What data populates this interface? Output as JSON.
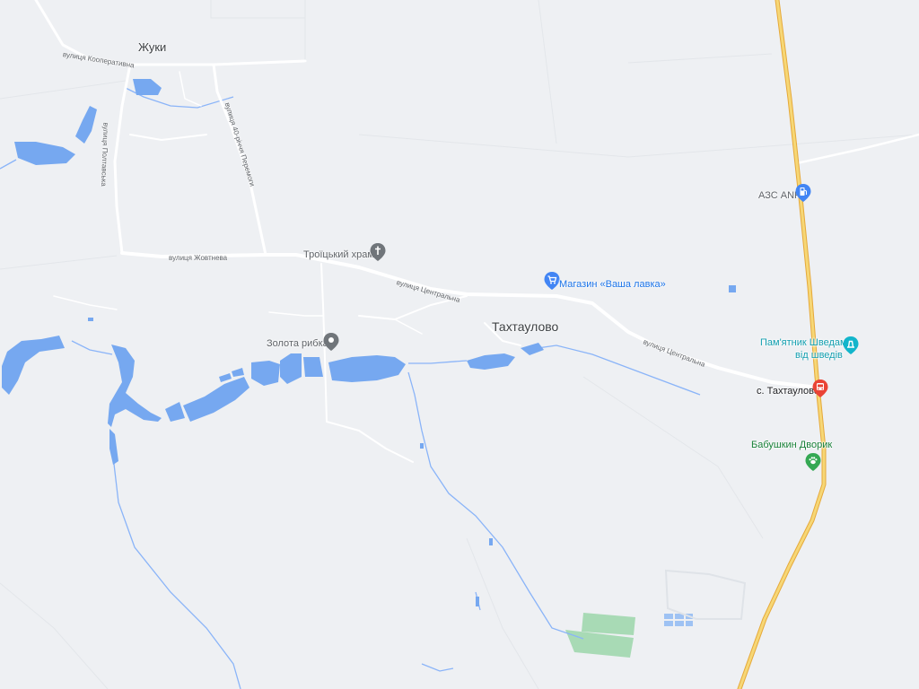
{
  "map": {
    "colors": {
      "land": "#eef0f3",
      "water": "#76a8f0",
      "road_minor": "#ffffff",
      "highway": "#f2c94c",
      "highway_edge": "#e6a93a",
      "park": "#a8dab5",
      "pin_gray": "#70757a",
      "pin_blue": "#4285f4",
      "pin_teal": "#12b5cb",
      "pin_red": "#ea4335",
      "pin_green": "#34a853"
    },
    "places": {
      "zhuky": "Жуки",
      "takhtaulovo": "Тахтаулово"
    },
    "streets": {
      "kooperatyvna": "вулиця Кооперативна",
      "poltavska": "вулиця Полтавська",
      "forty_years": "вулиця 40-річчя Перемоги",
      "zhovtneva": "вулиця Жовтнева",
      "tsentralna_1": "вулиця Центральна",
      "tsentralna_2": "вулиця Центральна"
    },
    "pois": {
      "church": {
        "label": "Троїцький храм",
        "icon": "church-icon"
      },
      "shop": {
        "label": "Магазин «Ваша лавка»",
        "icon": "shopping-cart-icon"
      },
      "fishing": {
        "label": "Золота рибка",
        "icon": "place-icon"
      },
      "gas": {
        "label": "АЗС ANP",
        "icon": "gas-station-icon"
      },
      "monument_line1": "Пам'ятник Шведам",
      "monument_line2": "від шведів",
      "monument_icon": "monument-icon",
      "bus_stop": {
        "label": "с. Тахтаулово",
        "icon": "bus-icon"
      },
      "restaurant": {
        "label": "Бабушкин Дворик",
        "icon": "paw-icon"
      }
    }
  }
}
